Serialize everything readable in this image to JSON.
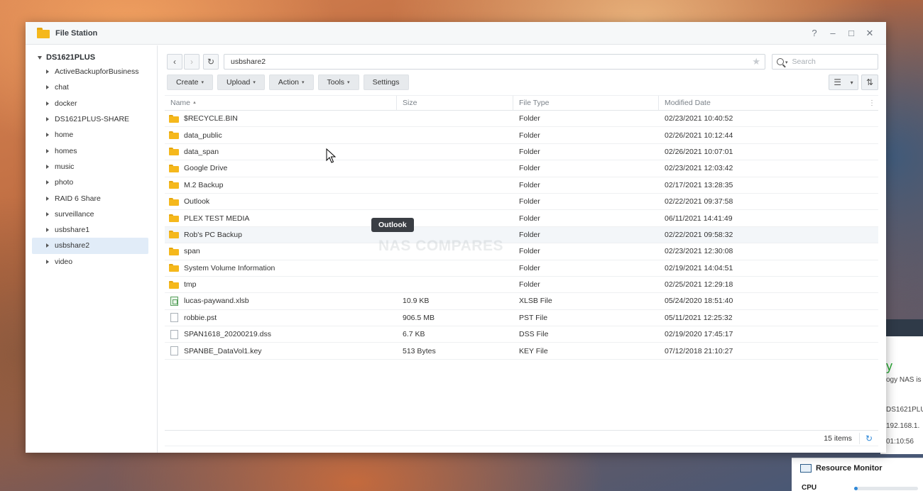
{
  "background_widget": {
    "green_text": "y",
    "lines": [
      "ogy NAS is",
      "DS1621PLU",
      "192.168.1.",
      "01:10:56"
    ]
  },
  "resource_monitor": {
    "title": "Resource Monitor",
    "cpu_label": "CPU",
    "cpu_usage_percent": 6
  },
  "window": {
    "title": "File Station",
    "controls": {
      "help": "?",
      "minimize": "–",
      "maximize": "□",
      "close": "✕"
    }
  },
  "sidebar": {
    "root": "DS1621PLUS",
    "items": [
      {
        "label": "ActiveBackupforBusiness"
      },
      {
        "label": "chat"
      },
      {
        "label": "docker"
      },
      {
        "label": "DS1621PLUS-SHARE"
      },
      {
        "label": "home"
      },
      {
        "label": "homes"
      },
      {
        "label": "music"
      },
      {
        "label": "photo"
      },
      {
        "label": "RAID 6 Share"
      },
      {
        "label": "surveillance"
      },
      {
        "label": "usbshare1"
      },
      {
        "label": "usbshare2"
      },
      {
        "label": "video"
      }
    ],
    "selected": "usbshare2"
  },
  "nav": {
    "back_icon": "‹",
    "forward_icon": "›",
    "refresh_icon": "↻",
    "path": "usbshare2",
    "favorite_icon": "★",
    "search_placeholder": "Search"
  },
  "toolbar": {
    "create": "Create",
    "upload": "Upload",
    "action": "Action",
    "tools": "Tools",
    "settings": "Settings",
    "list_view_icon": "☰",
    "dropdown_icon": "▾",
    "sort_icon": "⇅"
  },
  "table": {
    "columns": {
      "name": "Name",
      "size": "Size",
      "type": "File Type",
      "modified": "Modified Date"
    },
    "rows": [
      {
        "name": "$RECYCLE.BIN",
        "size": "",
        "type": "Folder",
        "modified": "02/23/2021 10:40:52",
        "icon": "folder"
      },
      {
        "name": "data_public",
        "size": "",
        "type": "Folder",
        "modified": "02/26/2021 10:12:44",
        "icon": "folder"
      },
      {
        "name": "data_span",
        "size": "",
        "type": "Folder",
        "modified": "02/26/2021 10:07:01",
        "icon": "folder"
      },
      {
        "name": "Google Drive",
        "size": "",
        "type": "Folder",
        "modified": "02/23/2021 12:03:42",
        "icon": "folder"
      },
      {
        "name": "M.2 Backup",
        "size": "",
        "type": "Folder",
        "modified": "02/17/2021 13:28:35",
        "icon": "folder"
      },
      {
        "name": "Outlook",
        "size": "",
        "type": "Folder",
        "modified": "02/22/2021 09:37:58",
        "icon": "folder"
      },
      {
        "name": "PLEX TEST MEDIA",
        "size": "",
        "type": "Folder",
        "modified": "06/11/2021 14:41:49",
        "icon": "folder"
      },
      {
        "name": "Rob's PC Backup",
        "size": "",
        "type": "Folder",
        "modified": "02/22/2021 09:58:32",
        "icon": "folder"
      },
      {
        "name": "span",
        "size": "",
        "type": "Folder",
        "modified": "02/23/2021 12:30:08",
        "icon": "folder"
      },
      {
        "name": "System Volume Information",
        "size": "",
        "type": "Folder",
        "modified": "02/19/2021 14:04:51",
        "icon": "folder"
      },
      {
        "name": "tmp",
        "size": "",
        "type": "Folder",
        "modified": "02/25/2021 12:29:18",
        "icon": "folder"
      },
      {
        "name": "lucas-paywand.xlsb",
        "size": "10.9 KB",
        "type": "XLSB File",
        "modified": "05/24/2020 18:51:40",
        "icon": "xls"
      },
      {
        "name": "robbie.pst",
        "size": "906.5 MB",
        "type": "PST File",
        "modified": "05/11/2021 12:25:32",
        "icon": "file"
      },
      {
        "name": "SPAN1618_20200219.dss",
        "size": "6.7 KB",
        "type": "DSS File",
        "modified": "02/19/2020 17:45:17",
        "icon": "file"
      },
      {
        "name": "SPANBE_DataVol1.key",
        "size": "513 Bytes",
        "type": "KEY File",
        "modified": "07/12/2018 21:10:27",
        "icon": "file"
      }
    ]
  },
  "status": {
    "items_count": "15 items",
    "refresh_icon": "↻"
  },
  "tooltip": "Outlook",
  "watermark": "NAS COMPARES"
}
